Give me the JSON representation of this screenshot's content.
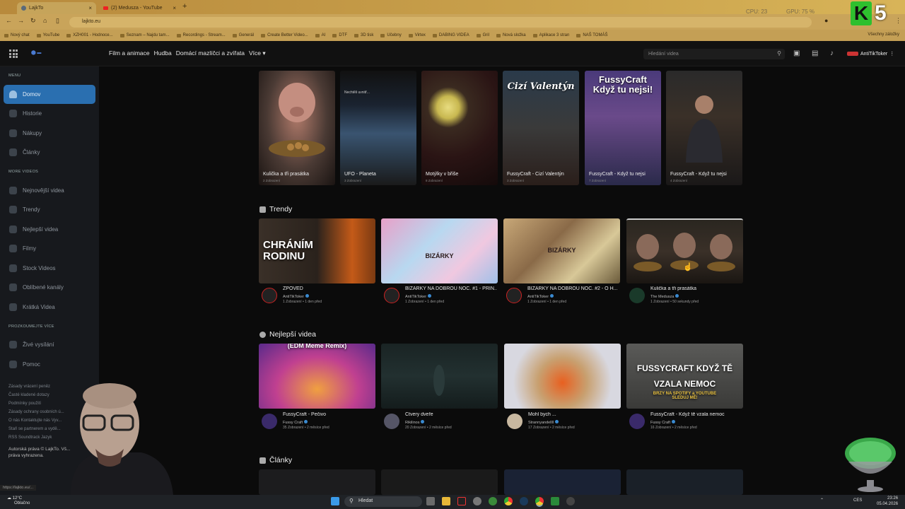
{
  "browser": {
    "tabs": [
      {
        "label": "LajkTo",
        "active": true
      },
      {
        "label": "(2) Medusza - YouTube",
        "active": false
      }
    ],
    "url": "lajkto.eu",
    "sysinfo": [
      "CPU: 23",
      "GPU: 75 %"
    ],
    "bookmarks": [
      "Nový chat",
      "YouTube",
      "XZH001 - Hodnoce...",
      "Seznam – Najdu tam...",
      "Recordings - Stream...",
      "Generál",
      "Create Better Video...",
      "AI",
      "DTF",
      "3D tisk",
      "Učebny",
      "Virtex",
      "DABING VIDEA",
      "Gril",
      "Nová složka",
      "Aplikace 3 stran",
      "NAŠ TOMÁŠ"
    ],
    "all_bookmarks": "Všechny záložky",
    "status_url": "https://lajkto.eu/..."
  },
  "header": {
    "nav": [
      "Film a animace",
      "Hudba",
      "Domácí mazlíčci a zvířata",
      "Více"
    ],
    "search_placeholder": "Hledání videa",
    "user": "AntiTikToker"
  },
  "sidebar": {
    "menu_heading": "MENU",
    "menu_items": [
      "Domov",
      "Historie",
      "Nákupy",
      "Články"
    ],
    "more_heading": "MORE VIDEOS",
    "more_items": [
      "Nejnovější videa",
      "Trendy",
      "Nejlepší videa",
      "Filmy",
      "Stock Videos",
      "Oblíbené kanály",
      "Krátká Videa"
    ],
    "explore_heading": "PROZKOUMEJTE VÍCE",
    "explore_items": [
      "Živé vysílání",
      "Pomoc"
    ],
    "footer_links": [
      "Zásady vrácení peněz",
      "Časté kladené dotazy",
      "Podmínky použití",
      "Zásady ochrany osobních ú...",
      "O nás  Kontaktujte nás  Vyv...",
      "Staň se partnerem a vydě...",
      "RSS  Soundtrack  Jazyk"
    ],
    "rights": "Autorská práva © LajkTo. Vš... práva vyhrazena."
  },
  "shorts": [
    {
      "title": "Kulička a tři prasátka",
      "views": "2 Zobrazení",
      "overlay": ""
    },
    {
      "title": "UFO - Planeta",
      "views": "3 Zobrazení",
      "overlay": "Nechtěli uvnitř..."
    },
    {
      "title": "Motýlky v břiše",
      "views": "8 Zobrazení",
      "overlay": ""
    },
    {
      "title": "FussyCraft - Cizí Valentýn",
      "views": "3 Zobrazení",
      "overlay": "Cizí Valentýn"
    },
    {
      "title": "FussyCraft - Když tu nejsi",
      "views": "7 Zobrazení",
      "overlay": "FussyCraft Když tu nejsi!"
    },
    {
      "title": "FussyCraft - Když tu nejsi",
      "views": "4 Zobrazení",
      "overlay": ""
    }
  ],
  "trendy": {
    "title": "Trendy",
    "videos": [
      {
        "title": "ZPOVĚĎ",
        "channel": "AntiTikToker",
        "meta": "1 Zobrazení • 1 den před",
        "thumb_text": "CHRÁNÍM RODINU"
      },
      {
        "title": "BIZÁRKY NA DOBROU NOC. #1 - PRIN...",
        "channel": "AntiTikToker",
        "meta": "1 Zobrazení • 1 den před",
        "thumb_text": "BIZÁRKY"
      },
      {
        "title": "BIZÁRKY NA DOBROU NOC. #2 - O H...",
        "channel": "AntiTikToker",
        "meta": "1 Zobrazení • 1 den před",
        "thumb_text": "BIZÁRKY"
      },
      {
        "title": "Kulička a tři prasátka",
        "channel": "The Medusza",
        "meta": "1 Zobrazení • 50 sekundy před",
        "thumb_text": ""
      }
    ]
  },
  "nejlepsi": {
    "title": "Nejlepší videa",
    "videos": [
      {
        "title": "FussyCraft - Pečivo",
        "channel": "Fussy Craft",
        "meta": "35 Zobrazení • 2 měsíce před",
        "thumb_text": "(EDM Meme Remix)"
      },
      {
        "title": "Čtvery dveře",
        "channel": "Rikilinos",
        "meta": "20 Zobrazení • 2 měsíce před",
        "thumb_text": ""
      },
      {
        "title": "Mohl bych ...",
        "channel": "Strannyandellll",
        "meta": "17 Zobrazení • 2 měsíce před",
        "thumb_text": ""
      },
      {
        "title": "FussyCraft - Když tě vzala nemoc",
        "channel": "Fussy Craft",
        "meta": "16 Zobrazení • 2 měsíce před",
        "thumb_text": "FUSSYCRAFT KDYŽ TĚ VZALA NEMOC"
      }
    ],
    "thumb_sub": "BRZY NA SPOTIFY a YOUTUBE SLEDUJ MĚ!"
  },
  "clanky": {
    "title": "Články"
  },
  "taskbar": {
    "search": "Hledat",
    "weather": [
      "12°C",
      "Oblačno"
    ],
    "lang": "CES",
    "time": "23:26",
    "date": "05.04.2026"
  },
  "overlay": {
    "k_letter": "K",
    "number": "5"
  }
}
